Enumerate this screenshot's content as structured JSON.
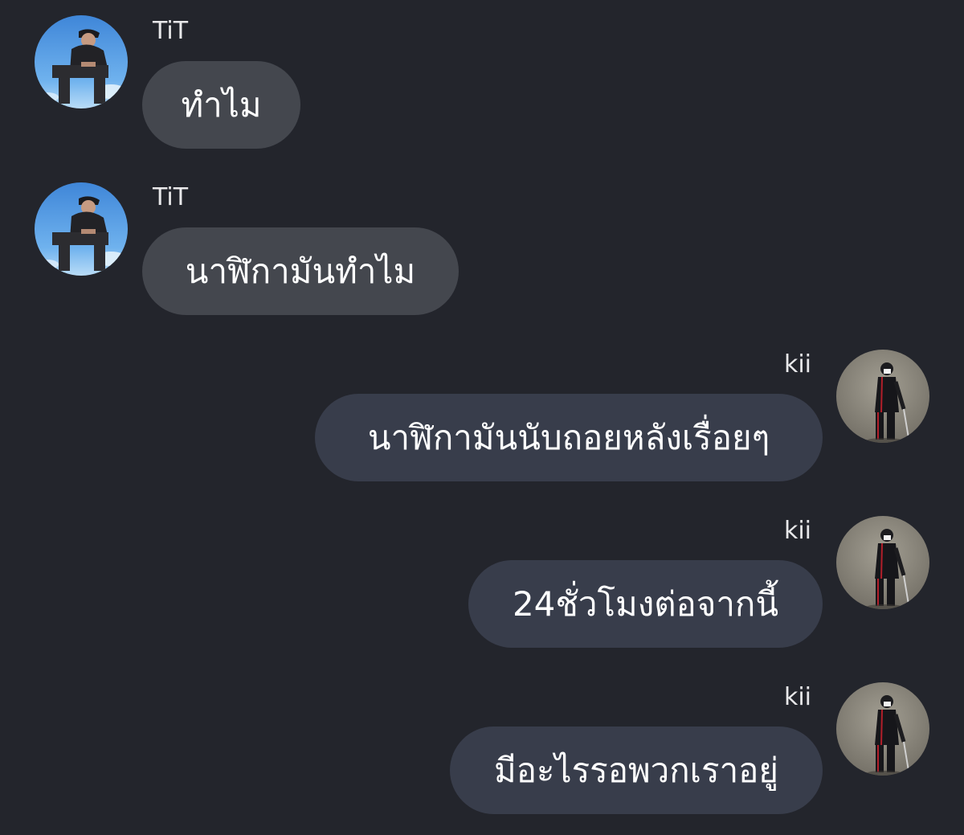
{
  "conversation": {
    "messages": [
      {
        "sender": "TiT",
        "text": "ทำไม"
      },
      {
        "sender": "TiT",
        "text": "นาฬิกามันทำไม"
      },
      {
        "sender": "kii",
        "text": "นาฬิกามันนับถอยหลังเรื่อยๆ"
      },
      {
        "sender": "kii",
        "text": "24ชั่วโมงต่อจากนี้"
      },
      {
        "sender": "kii",
        "text": "มีอะไรรอพวกเราอยู่"
      }
    ]
  },
  "colors": {
    "background": "#23252c",
    "incoming_bubble": "#44474e",
    "outgoing_bubble": "#383d4b",
    "text": "#ffffff"
  },
  "icons": {
    "incoming_avatar": "avatar-photo-sky",
    "outgoing_avatar": "avatar-photo-wall"
  }
}
